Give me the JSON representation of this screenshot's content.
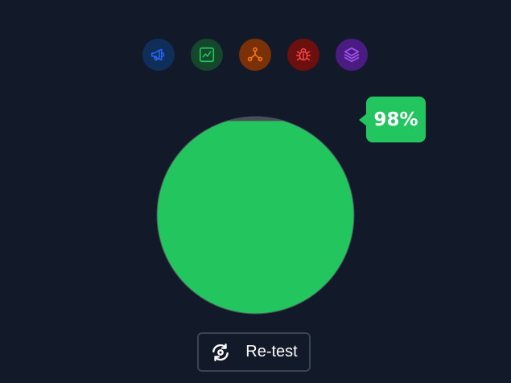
{
  "toolbar": {
    "icons": [
      {
        "name": "megaphone-icon",
        "color": "#2563eb",
        "bg": "#0f2f5a"
      },
      {
        "name": "chart-icon",
        "color": "#22c55e",
        "bg": "#14472b"
      },
      {
        "name": "network-icon",
        "color": "#f97316",
        "bg": "#7a3108"
      },
      {
        "name": "bug-icon",
        "color": "#ef4444",
        "bg": "#6b0f0f"
      },
      {
        "name": "layers-icon",
        "color": "#a855f7",
        "bg": "#4a1c82"
      }
    ]
  },
  "meter": {
    "percent_label": "98%",
    "fill_fraction": 0.98,
    "fill_color": "#22c55e",
    "ring_color": "#4a4f57"
  },
  "actions": {
    "retest_label": "Re-test",
    "retest_icon": "refresh-icon"
  }
}
